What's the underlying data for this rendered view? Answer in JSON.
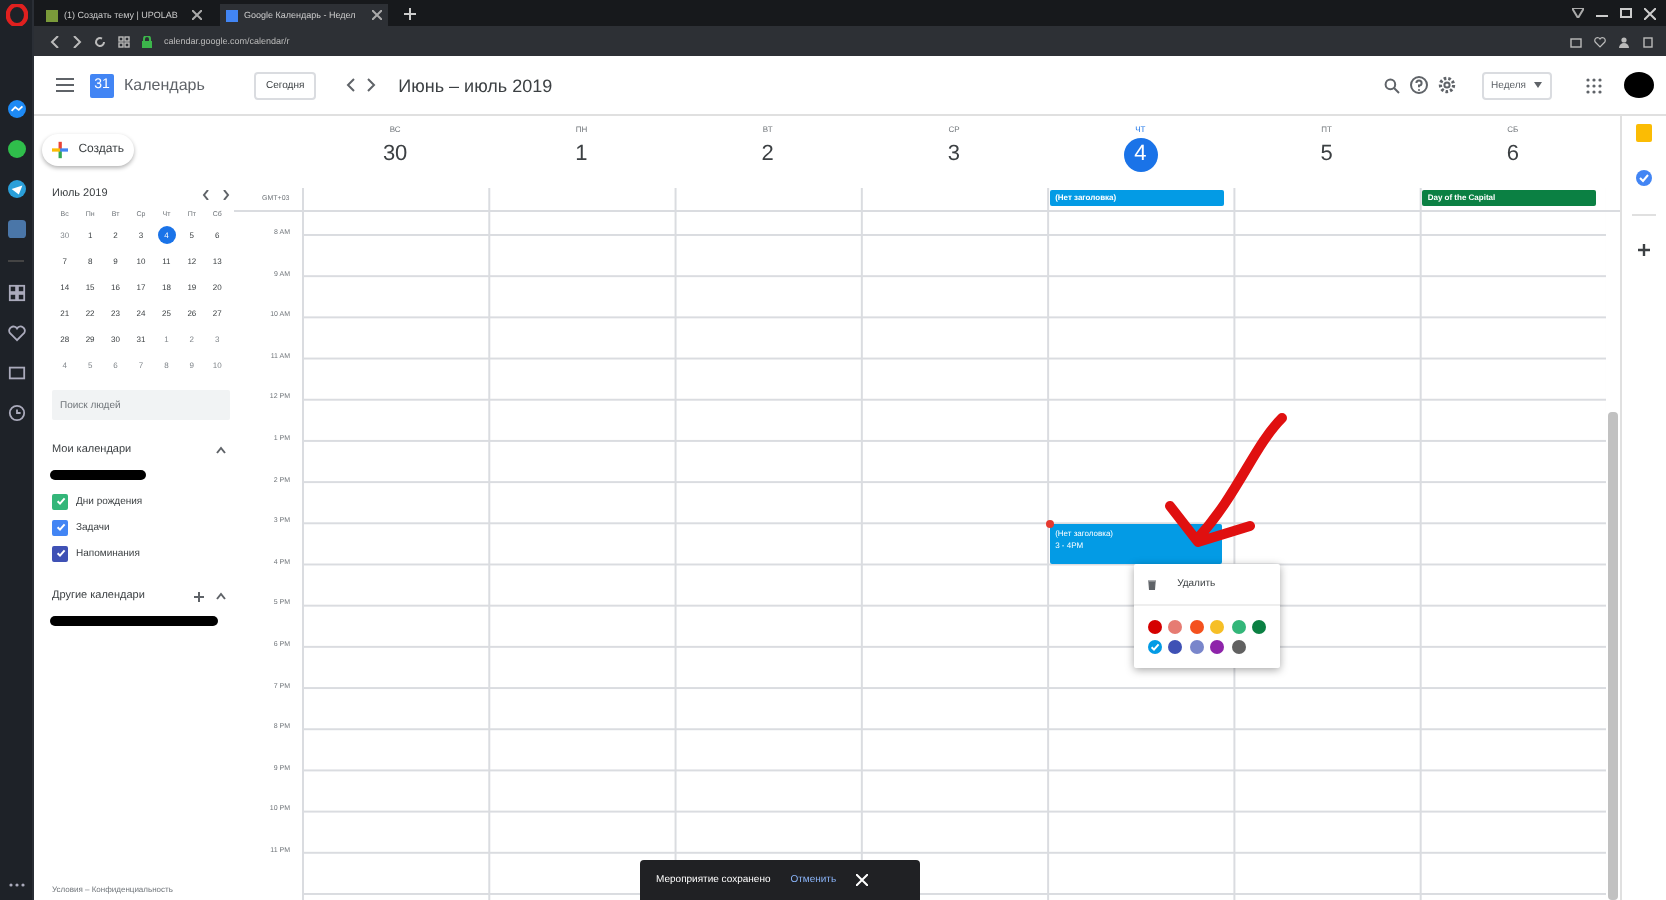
{
  "browser": {
    "tabs": [
      {
        "title": "(1) Создать тему | UPOLAB",
        "selected": false
      },
      {
        "title": "Google Календарь - Недел",
        "selected": true
      }
    ],
    "address": "calendar.google.com/calendar/r"
  },
  "header": {
    "logo_day": "31",
    "app_name": "Календарь",
    "today_button": "Сегодня",
    "date_range": "Июнь – июль 2019",
    "view_selector": "Неделя"
  },
  "create_button": "Создать",
  "mini_calendar": {
    "title": "Июль 2019",
    "weekdays": [
      "Вс",
      "Пн",
      "Вт",
      "Ср",
      "Чт",
      "Пт",
      "Сб"
    ],
    "weeks": [
      [
        {
          "day": "30",
          "in_month": false,
          "selected": false
        },
        {
          "day": "1",
          "in_month": true,
          "selected": false
        },
        {
          "day": "2",
          "in_month": true,
          "selected": false
        },
        {
          "day": "3",
          "in_month": true,
          "selected": false
        },
        {
          "day": "4",
          "in_month": true,
          "selected": true
        },
        {
          "day": "5",
          "in_month": true,
          "selected": false
        },
        {
          "day": "6",
          "in_month": true,
          "selected": false
        }
      ],
      [
        {
          "day": "7",
          "in_month": true,
          "selected": false
        },
        {
          "day": "8",
          "in_month": true,
          "selected": false
        },
        {
          "day": "9",
          "in_month": true,
          "selected": false
        },
        {
          "day": "10",
          "in_month": true,
          "selected": false
        },
        {
          "day": "11",
          "in_month": true,
          "selected": false
        },
        {
          "day": "12",
          "in_month": true,
          "selected": false
        },
        {
          "day": "13",
          "in_month": true,
          "selected": false
        }
      ],
      [
        {
          "day": "14",
          "in_month": true,
          "selected": false
        },
        {
          "day": "15",
          "in_month": true,
          "selected": false
        },
        {
          "day": "16",
          "in_month": true,
          "selected": false
        },
        {
          "day": "17",
          "in_month": true,
          "selected": false
        },
        {
          "day": "18",
          "in_month": true,
          "selected": false
        },
        {
          "day": "19",
          "in_month": true,
          "selected": false
        },
        {
          "day": "20",
          "in_month": true,
          "selected": false
        }
      ],
      [
        {
          "day": "21",
          "in_month": true,
          "selected": false
        },
        {
          "day": "22",
          "in_month": true,
          "selected": false
        },
        {
          "day": "23",
          "in_month": true,
          "selected": false
        },
        {
          "day": "24",
          "in_month": true,
          "selected": false
        },
        {
          "day": "25",
          "in_month": true,
          "selected": false
        },
        {
          "day": "26",
          "in_month": true,
          "selected": false
        },
        {
          "day": "27",
          "in_month": true,
          "selected": false
        }
      ],
      [
        {
          "day": "28",
          "in_month": true,
          "selected": false
        },
        {
          "day": "29",
          "in_month": true,
          "selected": false
        },
        {
          "day": "30",
          "in_month": true,
          "selected": false
        },
        {
          "day": "31",
          "in_month": true,
          "selected": false
        },
        {
          "day": "1",
          "in_month": false,
          "selected": false
        },
        {
          "day": "2",
          "in_month": false,
          "selected": false
        },
        {
          "day": "3",
          "in_month": false,
          "selected": false
        }
      ],
      [
        {
          "day": "4",
          "in_month": false,
          "selected": false
        },
        {
          "day": "5",
          "in_month": false,
          "selected": false
        },
        {
          "day": "6",
          "in_month": false,
          "selected": false
        },
        {
          "day": "7",
          "in_month": false,
          "selected": false
        },
        {
          "day": "8",
          "in_month": false,
          "selected": false
        },
        {
          "day": "9",
          "in_month": false,
          "selected": false
        },
        {
          "day": "10",
          "in_month": false,
          "selected": false
        }
      ]
    ]
  },
  "people_search": {
    "placeholder": "Поиск людей"
  },
  "my_calendars": {
    "title": "Мои календари",
    "expanded": true,
    "items": [
      {
        "label": "Дни рождения",
        "checked": true,
        "color": "#33b679"
      },
      {
        "label": "Задачи",
        "checked": true,
        "color": "#4285f4"
      },
      {
        "label": "Напоминания",
        "checked": true,
        "color": "#3f51b5"
      }
    ]
  },
  "other_calendars": {
    "title": "Другие календари",
    "expanded": true
  },
  "footer": "Условия – Конфиденциальность",
  "week": {
    "timezone": "GMT+03",
    "days": [
      {
        "weekday": "ВС",
        "date": "30",
        "today": false
      },
      {
        "weekday": "ПН",
        "date": "1",
        "today": false
      },
      {
        "weekday": "ВТ",
        "date": "2",
        "today": false
      },
      {
        "weekday": "СР",
        "date": "3",
        "today": false
      },
      {
        "weekday": "ЧТ",
        "date": "4",
        "today": true,
        "all_day": [
          {
            "title": "(Нет заголовка)",
            "color": "#039be5"
          }
        ],
        "events": [
          {
            "title": "(Нет заголовка)",
            "time": "3 - 4PM",
            "color": "#039be5",
            "popup": {
              "delete": "Удалить",
              "colors": [
                {
                  "color": "#d50000",
                  "selected": false
                },
                {
                  "color": "#e67c73",
                  "selected": false
                },
                {
                  "color": "#f4511e",
                  "selected": false
                },
                {
                  "color": "#f6bf26",
                  "selected": false
                },
                {
                  "color": "#33b679",
                  "selected": false
                },
                {
                  "color": "#0b8043",
                  "selected": false
                },
                {
                  "color": "#039be5",
                  "selected": true
                },
                {
                  "color": "#3f51b5",
                  "selected": false
                },
                {
                  "color": "#7986cb",
                  "selected": false
                },
                {
                  "color": "#8e24aa",
                  "selected": false
                },
                {
                  "color": "#616161",
                  "selected": false
                }
              ]
            }
          }
        ]
      },
      {
        "weekday": "ПТ",
        "date": "5",
        "today": false
      },
      {
        "weekday": "СБ",
        "date": "6",
        "today": false,
        "all_day": [
          {
            "title": "Day of the Capital",
            "color": "#0b8043"
          }
        ]
      }
    ],
    "hours": [
      "8 AM",
      "9 AM",
      "10 AM",
      "11 AM",
      "12 PM",
      "1 PM",
      "2 PM",
      "3 PM",
      "4 PM",
      "5 PM",
      "6 PM",
      "7 PM",
      "8 PM",
      "9 PM",
      "10 PM",
      "11 PM"
    ]
  },
  "snackbar": {
    "message": "Мероприятие сохранено",
    "action": "Отменить"
  }
}
